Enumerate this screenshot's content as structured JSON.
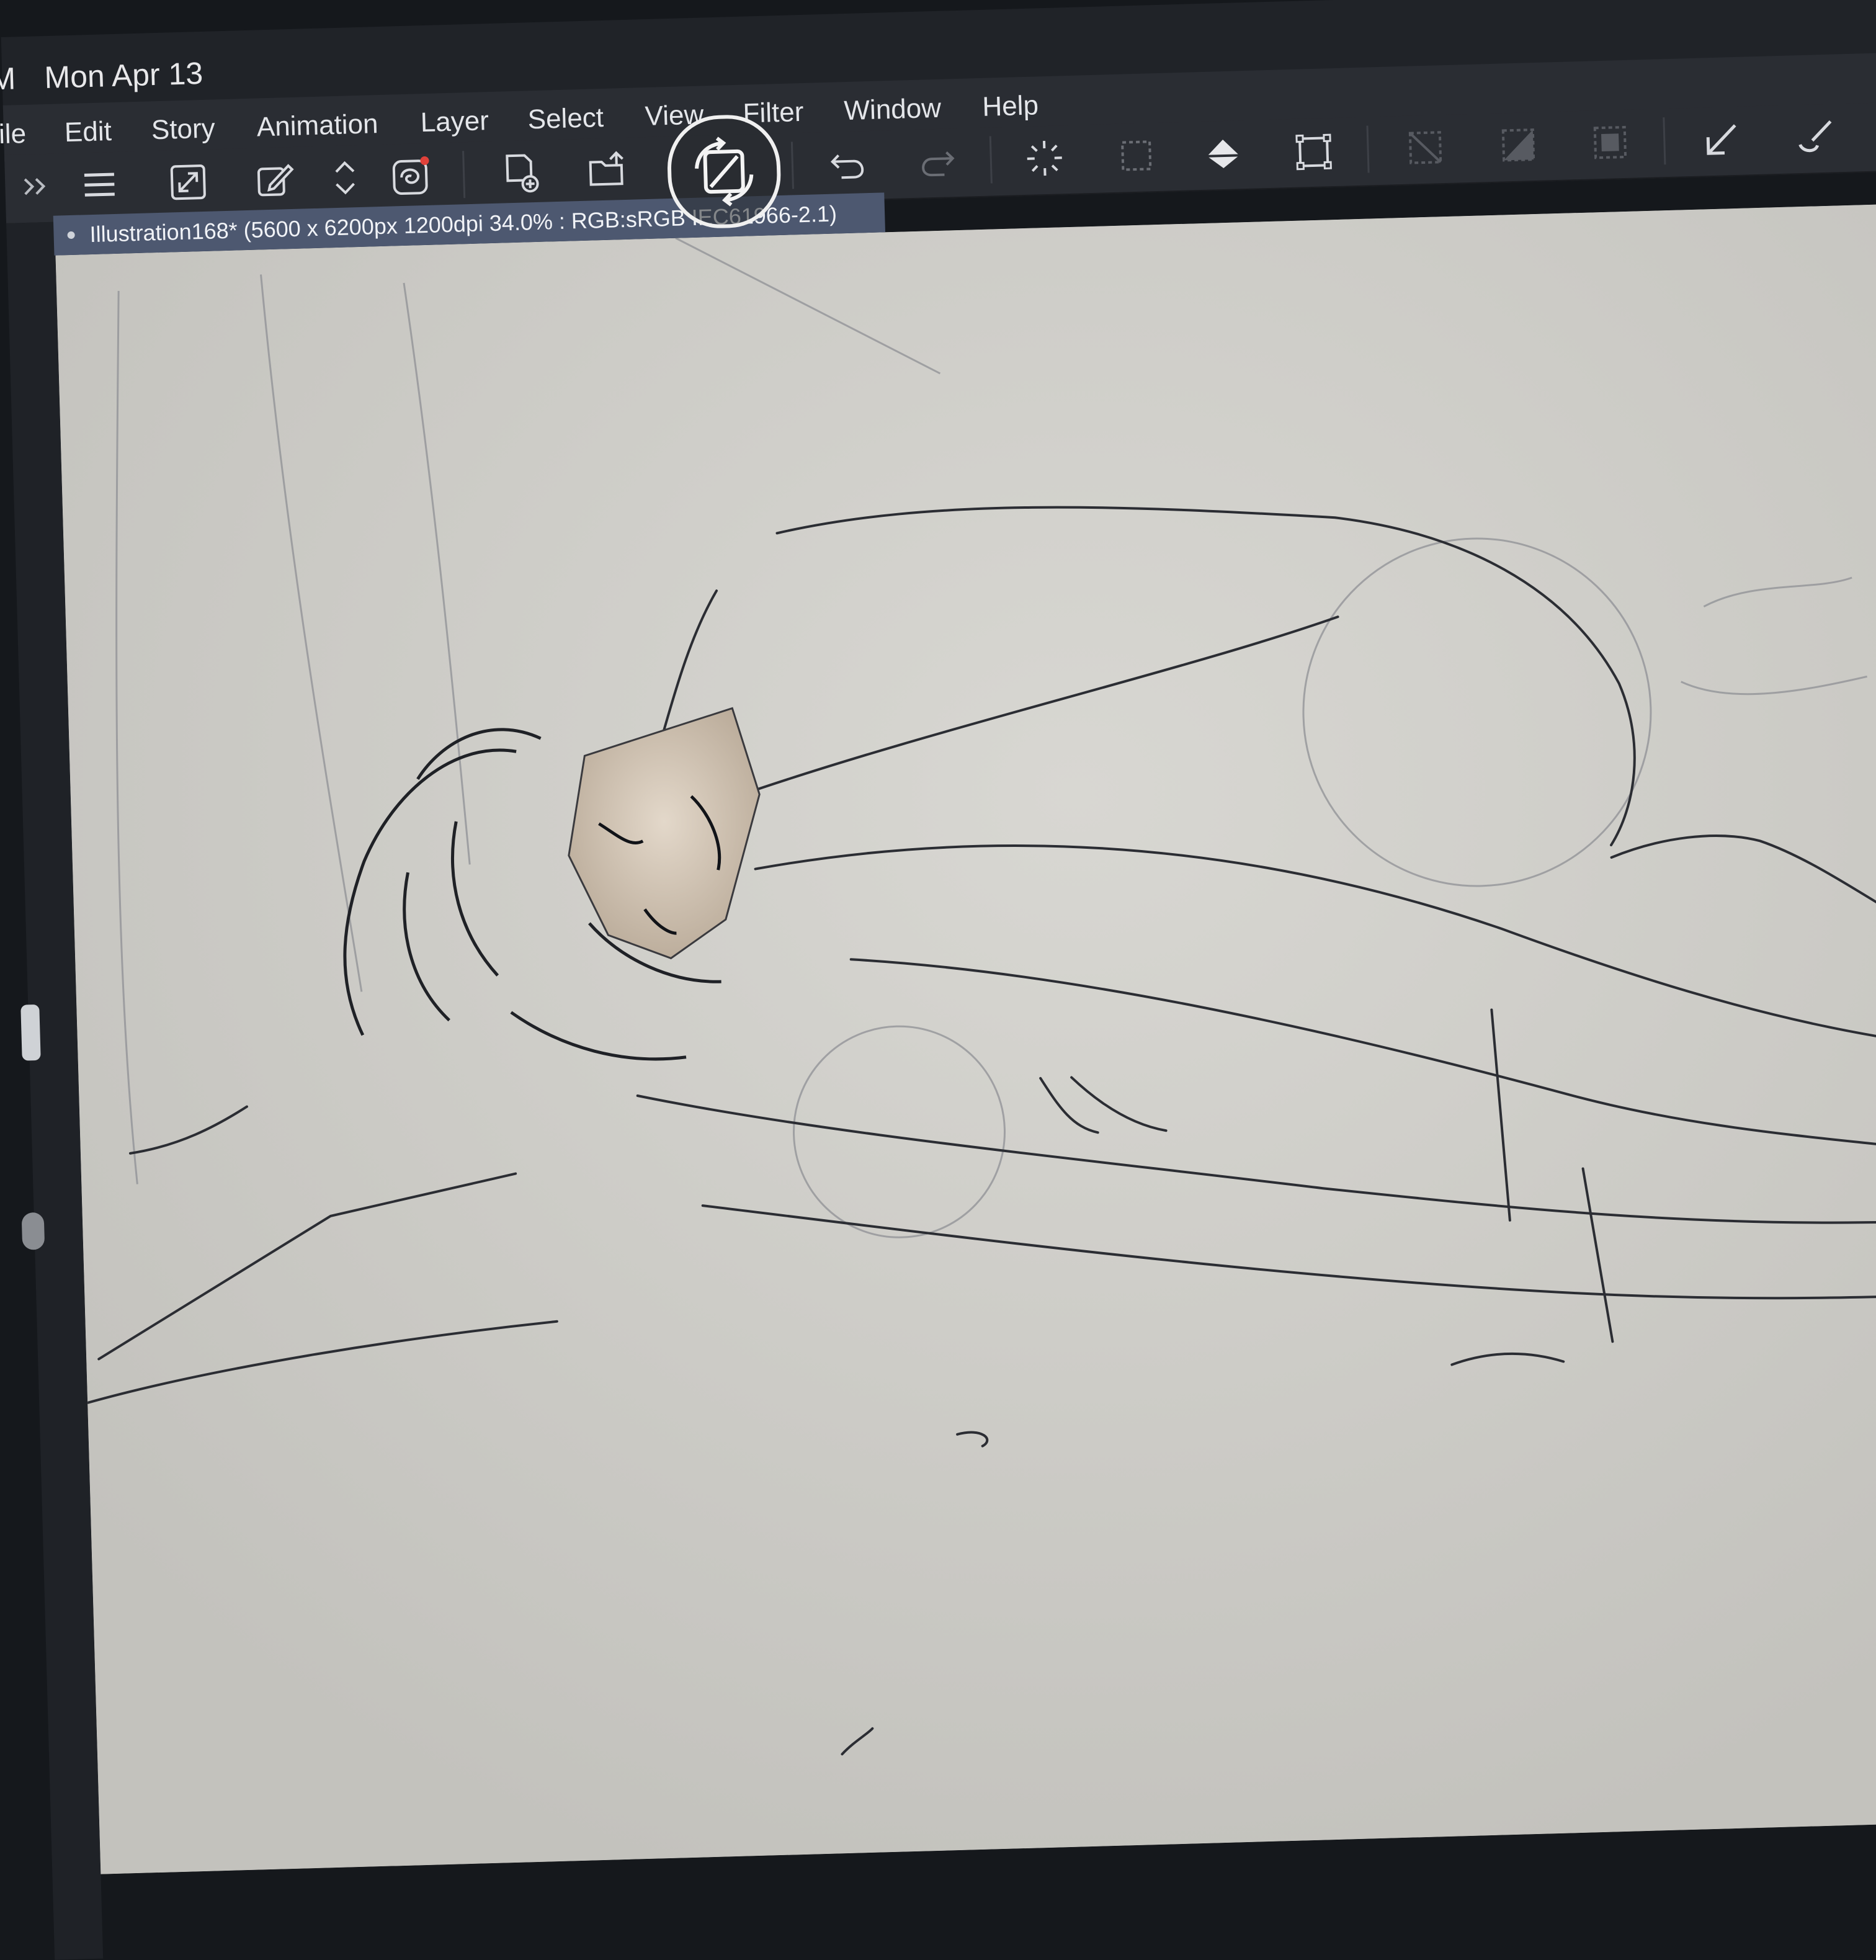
{
  "status_bar": {
    "time_fragment": "M",
    "date": "Mon Apr 13"
  },
  "menu": {
    "items": [
      {
        "label": "ile"
      },
      {
        "label": "Edit"
      },
      {
        "label": "Story"
      },
      {
        "label": "Animation"
      },
      {
        "label": "Layer"
      },
      {
        "label": "Select"
      },
      {
        "label": "View"
      },
      {
        "label": "Filter"
      },
      {
        "label": "Window"
      },
      {
        "label": "Help"
      }
    ]
  },
  "toolbar": {
    "icons": [
      "expand-panels-icon",
      "hamburger-menu-icon",
      "fullscreen-icon",
      "edit-icon",
      "up-down-icon",
      "quick-access-icon",
      "new-file-icon",
      "open-folder-icon",
      "undo-icon",
      "redo-icon",
      "loading-spinner-icon",
      "selection-icon",
      "fill-icon",
      "transform-icon",
      "deselect-icon",
      "invert-selection-icon",
      "show-selection-icon",
      "pen-tool-icon",
      "brush-tool-icon"
    ]
  },
  "document": {
    "tab_title": "Illustration168* (5600 x 6200px 1200dpi 34.0% : RGB:sRGB IEC61966-2.1)"
  },
  "overlay": {
    "icon": "canvas-rotate-icon"
  },
  "colors": {
    "chrome": "#2a2d33",
    "statusbar": "#202328",
    "doc_tab": "#4d5870",
    "canvas": "#c9c8c3",
    "sketch_line": "#2b2d33"
  }
}
